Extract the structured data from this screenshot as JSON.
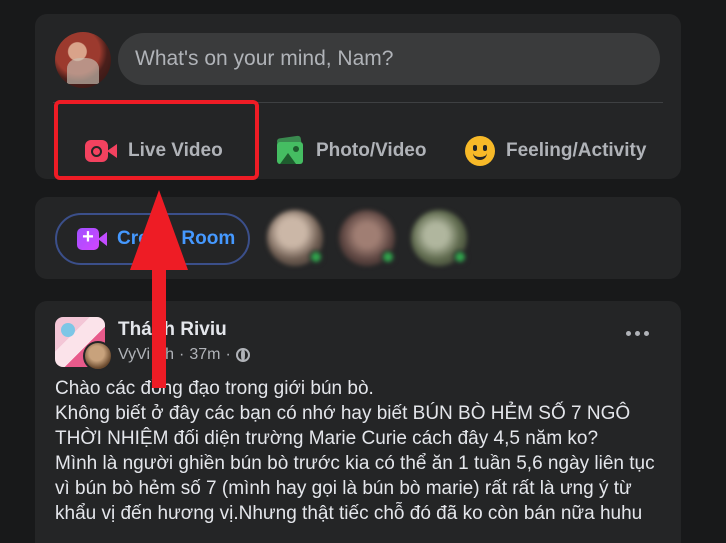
{
  "composer": {
    "placeholder": "What's on your mind, Nam?",
    "actions": {
      "live": "Live Video",
      "photo": "Photo/Video",
      "feeling": "Feeling/Activity"
    }
  },
  "rooms": {
    "create_room": "Create Room"
  },
  "post": {
    "author": "Thánh Riviu",
    "sub_author": "VyVi Ph",
    "time": "37m",
    "separator": "·",
    "text": "Chào các đồng đạo trong giới bún bò.\nKhông biết ở đây các bạn có nhớ hay biết BÚN BÒ HẺM SỐ 7 NGÔ THỜI NHIỆM đối diện trường Marie Curie cách đây 4,5 năm ko?\nMình là người ghiền bún bò trước kia có thể ăn 1 tuần 5,6 ngày liên tục vì bún bò hẻm số 7 (mình hay gọi là bún bò marie) rất rất là ưng ý từ khẩu vị đến hương vị.Nhưng thật tiếc chỗ đó đã ko còn bán nữa huhu"
  },
  "colors": {
    "background": "#18191a",
    "card": "#242526",
    "annotation_red": "#ee1c25",
    "live_icon": "#f3425f",
    "photo_icon": "#45bd62",
    "feeling_icon": "#f7b928",
    "room_text": "#4599ff",
    "online_dot": "#31a24c"
  },
  "icons": [
    "live-video-icon",
    "photo-video-icon",
    "feeling-icon",
    "create-room-icon",
    "globe-icon",
    "more-icon"
  ]
}
